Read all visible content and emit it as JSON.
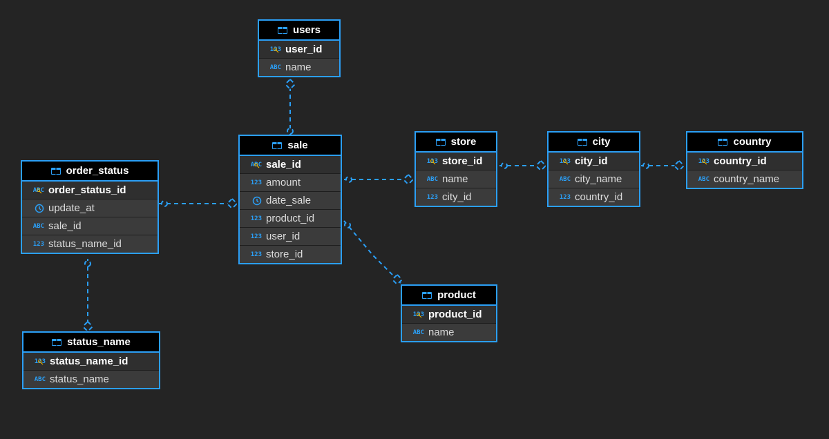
{
  "tables": {
    "users": {
      "title": "users",
      "columns": [
        {
          "name": "user_id",
          "type": "num",
          "pk": true
        },
        {
          "name": "name",
          "type": "abc",
          "pk": false
        }
      ]
    },
    "sale": {
      "title": "sale",
      "columns": [
        {
          "name": "sale_id",
          "type": "abc",
          "pk": true
        },
        {
          "name": "amount",
          "type": "num",
          "pk": false
        },
        {
          "name": "date_sale",
          "type": "clock",
          "pk": false
        },
        {
          "name": "product_id",
          "type": "num",
          "pk": false
        },
        {
          "name": "user_id",
          "type": "num",
          "pk": false
        },
        {
          "name": "store_id",
          "type": "num",
          "pk": false
        }
      ]
    },
    "order_status": {
      "title": "order_status",
      "columns": [
        {
          "name": "order_status_id",
          "type": "abc",
          "pk": true
        },
        {
          "name": "update_at",
          "type": "clock",
          "pk": false
        },
        {
          "name": "sale_id",
          "type": "abc",
          "pk": false
        },
        {
          "name": "status_name_id",
          "type": "num",
          "pk": false
        }
      ]
    },
    "status_name": {
      "title": "status_name",
      "columns": [
        {
          "name": "status_name_id",
          "type": "num",
          "pk": true
        },
        {
          "name": "status_name",
          "type": "abc",
          "pk": false
        }
      ]
    },
    "store": {
      "title": "store",
      "columns": [
        {
          "name": "store_id",
          "type": "num",
          "pk": true
        },
        {
          "name": "name",
          "type": "abc",
          "pk": false
        },
        {
          "name": "city_id",
          "type": "num",
          "pk": false
        }
      ]
    },
    "product": {
      "title": "product",
      "columns": [
        {
          "name": "product_id",
          "type": "num",
          "pk": true
        },
        {
          "name": "name",
          "type": "abc",
          "pk": false
        }
      ]
    },
    "city": {
      "title": "city",
      "columns": [
        {
          "name": "city_id",
          "type": "num",
          "pk": true
        },
        {
          "name": "city_name",
          "type": "abc",
          "pk": false
        },
        {
          "name": "country_id",
          "type": "num",
          "pk": false
        }
      ]
    },
    "country": {
      "title": "country",
      "columns": [
        {
          "name": "country_id",
          "type": "num",
          "pk": true
        },
        {
          "name": "country_name",
          "type": "abc",
          "pk": false
        }
      ]
    }
  },
  "relationships": [
    {
      "from": "sale.user_id",
      "to": "users.user_id"
    },
    {
      "from": "sale.store_id",
      "to": "store.store_id"
    },
    {
      "from": "sale.product_id",
      "to": "product.product_id"
    },
    {
      "from": "order_status.sale_id",
      "to": "sale.sale_id"
    },
    {
      "from": "order_status.status_name_id",
      "to": "status_name.status_name_id"
    },
    {
      "from": "store.city_id",
      "to": "city.city_id"
    },
    {
      "from": "city.country_id",
      "to": "country.country_id"
    }
  ]
}
